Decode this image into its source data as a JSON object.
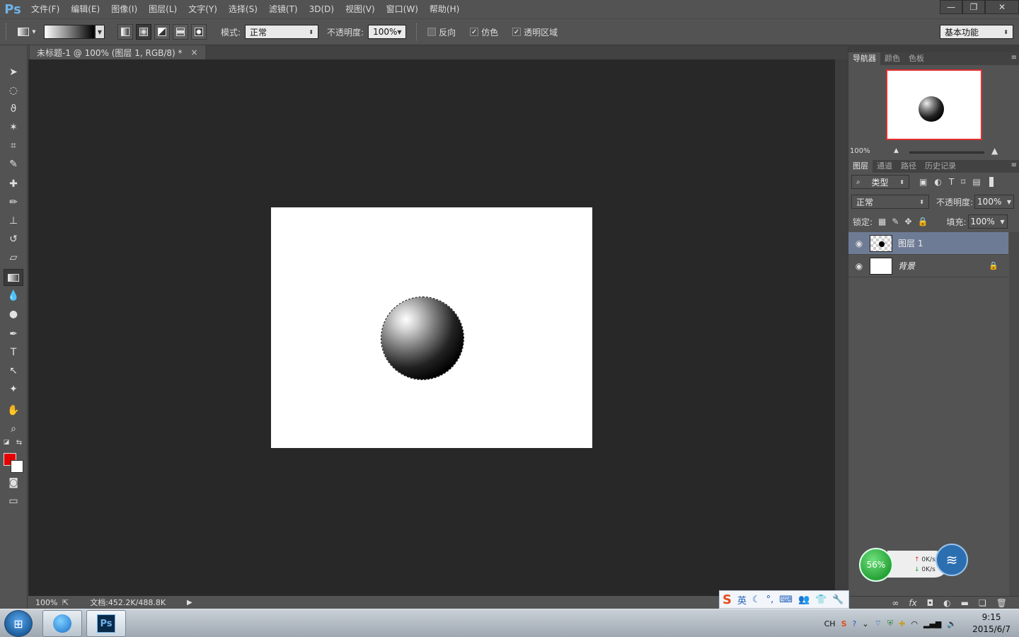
{
  "menubar": {
    "logo": "Ps",
    "items": [
      "文件(F)",
      "编辑(E)",
      "图像(I)",
      "图层(L)",
      "文字(Y)",
      "选择(S)",
      "滤镜(T)",
      "3D(D)",
      "视图(V)",
      "窗口(W)",
      "帮助(H)"
    ]
  },
  "options": {
    "mode_label": "模式:",
    "mode_value": "正常",
    "opacity_label": "不透明度:",
    "opacity_value": "100%",
    "reverse_label": "反向",
    "dither_label": "仿色",
    "transparency_label": "透明区域",
    "workspace_value": "基本功能"
  },
  "document": {
    "tab_title": "未标题-1 @ 100% (图层 1, RGB/8) *",
    "zoom": "100%",
    "doc_info": "文档:452.2K/488.8K"
  },
  "colors": {
    "foreground": "#e50000",
    "background": "#ffffff"
  },
  "navigator": {
    "tabs": [
      "导航器",
      "颜色",
      "色板"
    ],
    "zoom": "100%"
  },
  "layers_panel": {
    "tabs": [
      "图层",
      "通道",
      "路径",
      "历史记录"
    ],
    "filter_value": "类型",
    "blend_value": "正常",
    "opacity_label": "不透明度:",
    "opacity_value": "100%",
    "lock_label": "锁定:",
    "fill_label": "填充:",
    "fill_value": "100%",
    "layers": [
      {
        "name": "图层 1",
        "selected": true
      },
      {
        "name": "背景",
        "locked": true
      }
    ]
  },
  "net_widget": {
    "percent": "56%",
    "up": "0K/s",
    "down": "0K/s"
  },
  "ime": {
    "mode": "英"
  },
  "tray": {
    "lang": "CH",
    "time": "9:15",
    "date": "2015/6/7"
  }
}
